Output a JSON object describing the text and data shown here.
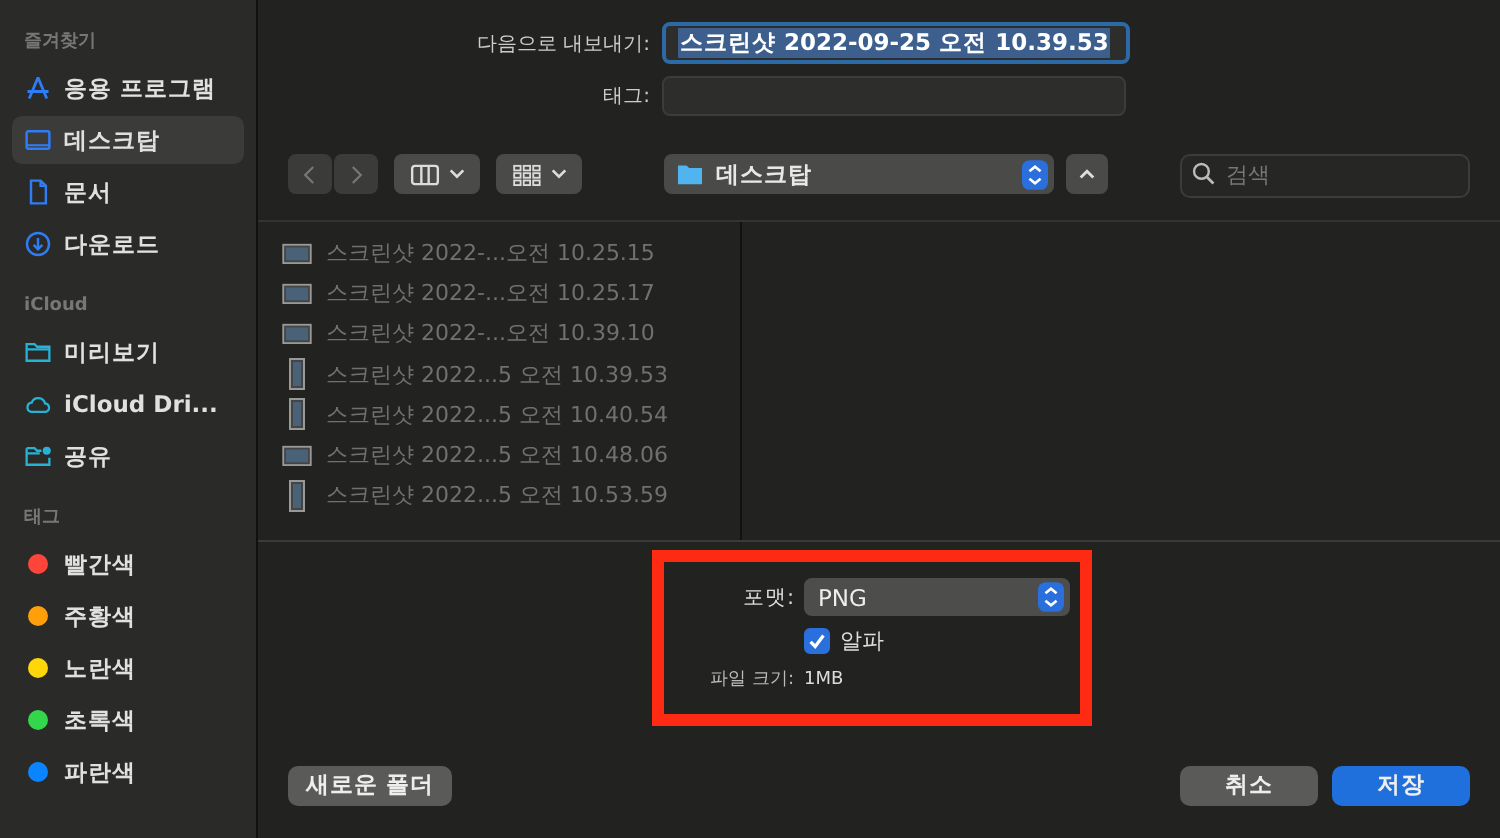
{
  "sidebar": {
    "sections": [
      {
        "title": "즐겨찾기",
        "items": [
          {
            "label": "응용 프로그램",
            "kind": "apps",
            "selected": false
          },
          {
            "label": "데스크탑",
            "kind": "desktop",
            "selected": true
          },
          {
            "label": "문서",
            "kind": "document",
            "selected": false
          },
          {
            "label": "다운로드",
            "kind": "download",
            "selected": false
          }
        ]
      },
      {
        "title": "iCloud",
        "items": [
          {
            "label": "미리보기",
            "kind": "folder",
            "selected": false
          },
          {
            "label": "iCloud Dri...",
            "kind": "cloud",
            "selected": false
          },
          {
            "label": "공유",
            "kind": "shared",
            "selected": false
          }
        ]
      },
      {
        "title": "태그",
        "items": [
          {
            "label": "빨간색",
            "kind": "tag",
            "color": "#ff453a",
            "selected": false
          },
          {
            "label": "주황색",
            "kind": "tag",
            "color": "#ff9f0a",
            "selected": false
          },
          {
            "label": "노란색",
            "kind": "tag",
            "color": "#ffd60a",
            "selected": false
          },
          {
            "label": "초록색",
            "kind": "tag",
            "color": "#32d74b",
            "selected": false
          },
          {
            "label": "파란색",
            "kind": "tag",
            "color": "#0a84ff",
            "selected": false
          }
        ]
      }
    ]
  },
  "export_as": {
    "label": "다음으로 내보내기:",
    "value": "스크린샷 2022-09-25 오전 10.39.53"
  },
  "tags_field": {
    "label": "태그:"
  },
  "toolbar": {
    "location": "데스크탑",
    "search": {
      "placeholder": "검색"
    }
  },
  "files": [
    {
      "name": "스크린샷 2022-...오전 10.25.15",
      "kind": "landscape"
    },
    {
      "name": "스크린샷 2022-...오전 10.25.17",
      "kind": "landscape"
    },
    {
      "name": "스크린샷 2022-...오전 10.39.10",
      "kind": "landscape"
    },
    {
      "name": "스크린샷 2022...5 오전 10.39.53",
      "kind": "portrait"
    },
    {
      "name": "스크린샷 2022...5 오전 10.40.54",
      "kind": "portrait"
    },
    {
      "name": "스크린샷 2022...5 오전 10.48.06",
      "kind": "landscape"
    },
    {
      "name": "스크린샷 2022...5 오전 10.53.59",
      "kind": "portrait"
    }
  ],
  "options": {
    "format_label": "포맷:",
    "format": "PNG",
    "alpha": {
      "label": "알파",
      "checked": true
    },
    "size_label": "파일 크기:",
    "size": "1MB"
  },
  "buttons": {
    "new_folder": "새로운 폴더",
    "cancel": "취소",
    "save": "저장"
  }
}
